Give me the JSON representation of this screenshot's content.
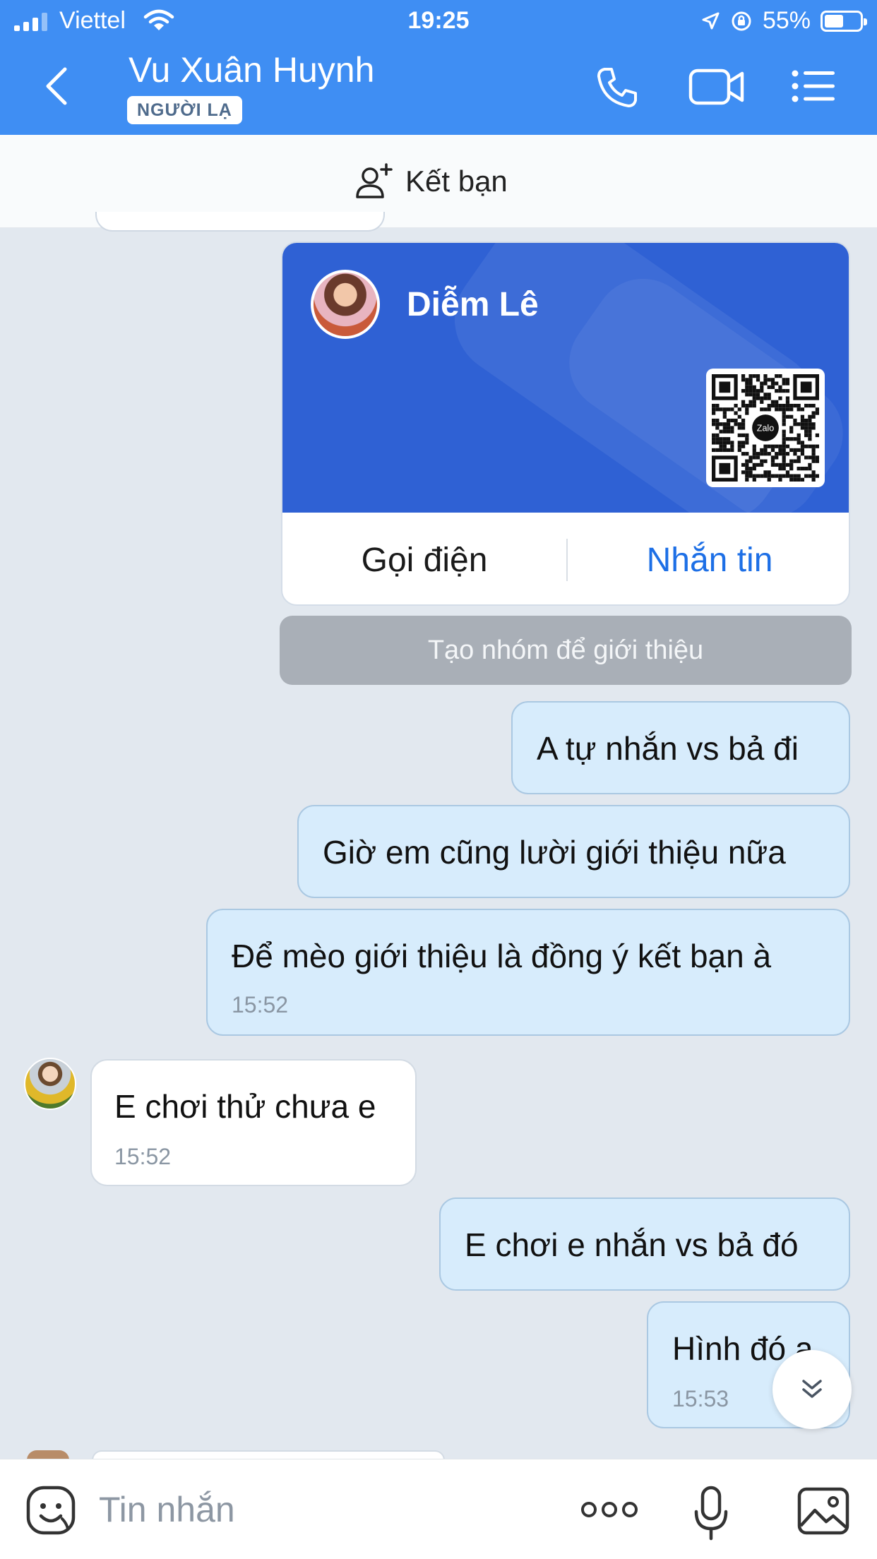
{
  "status_bar": {
    "carrier": "Viettel",
    "time": "19:25",
    "battery": "55%",
    "battery_level": 0.55
  },
  "header": {
    "contact_name": "Vu Xuân Huynh",
    "badge": "NGƯỜI LẠ",
    "icons": [
      "back-icon",
      "phone-icon",
      "video-call-icon",
      "menu-icon"
    ]
  },
  "add_friend": {
    "label": "Kết bạn",
    "icon": "add-user-icon"
  },
  "contact_card": {
    "name": "Diễm Lê",
    "qr_logo_text": "Zalo",
    "call_label": "Gọi điện",
    "message_label": "Nhắn tin"
  },
  "intro_button": {
    "label": "Tạo nhóm để giới thiệu"
  },
  "messages": [
    {
      "direction": "out",
      "text": "A tự nhắn vs bả đi"
    },
    {
      "direction": "out",
      "text": "Giờ em cũng lười giới thiệu nữa"
    },
    {
      "direction": "out",
      "text": "Để mèo giới thiệu là đồng ý kết bạn à",
      "time": "15:52"
    },
    {
      "direction": "in",
      "text": "E chơi thử chưa e",
      "time": "15:52"
    },
    {
      "direction": "out",
      "text": "E chơi e nhắn vs bả đó"
    },
    {
      "direction": "out",
      "text": "Hình đó a",
      "time": "15:53"
    }
  ],
  "input_bar": {
    "placeholder": "Tin nhắn",
    "icons": [
      "sticker-icon",
      "more-icon",
      "microphone-icon",
      "image-icon"
    ]
  },
  "colors": {
    "header_blue": "#3f8ef3",
    "card_blue": "#2f61d4",
    "outgoing_bubble": "#d7ecfc",
    "incoming_bubble": "#ffffff",
    "chat_background": "#e2e8ef",
    "link_blue": "#1d6fe6"
  }
}
